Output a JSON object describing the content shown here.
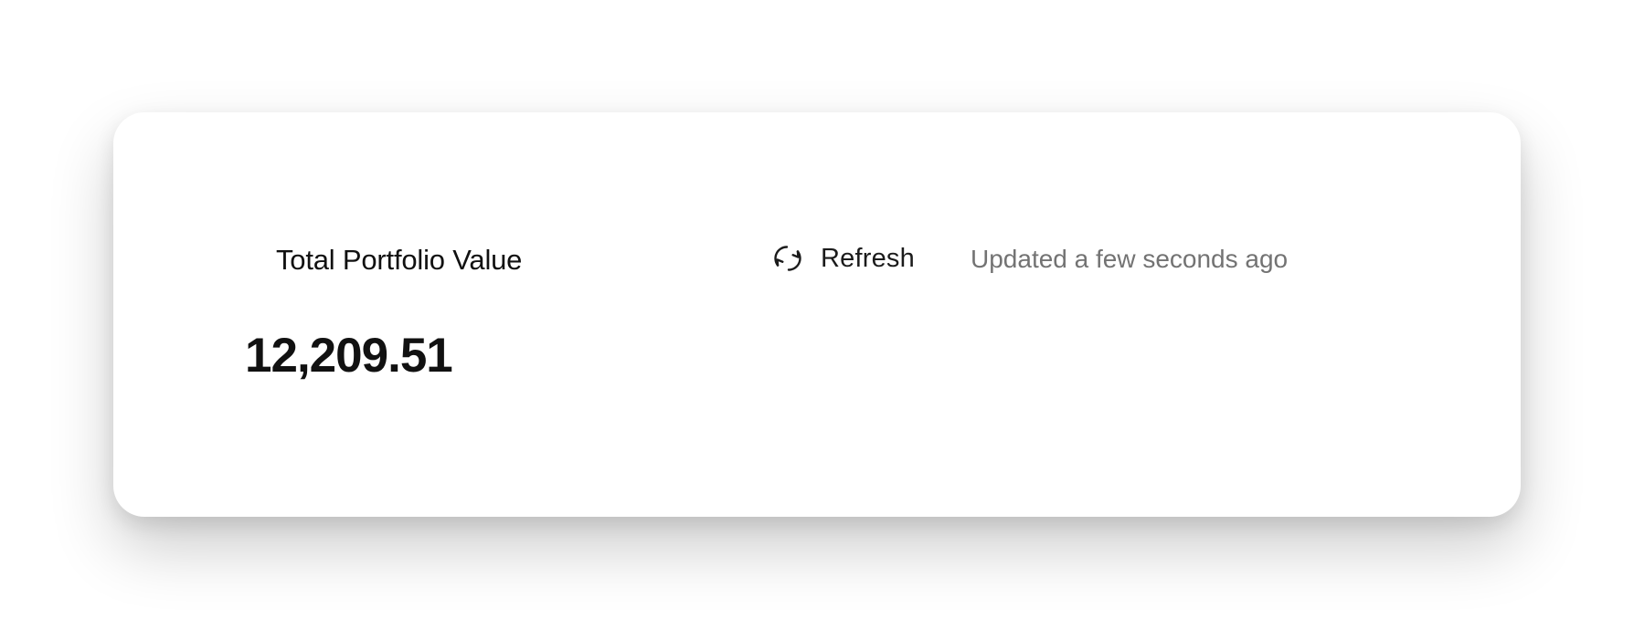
{
  "portfolio": {
    "title": "Total Portfolio Value",
    "value": "12,209.51",
    "refresh_label": "Refresh",
    "updated_text": "Updated a few seconds ago",
    "refresh_icon": "refresh-icon"
  },
  "colors": {
    "background": "#ffffff",
    "card": "#ffffff",
    "primary_text": "#111111",
    "secondary_text": "#737373"
  }
}
